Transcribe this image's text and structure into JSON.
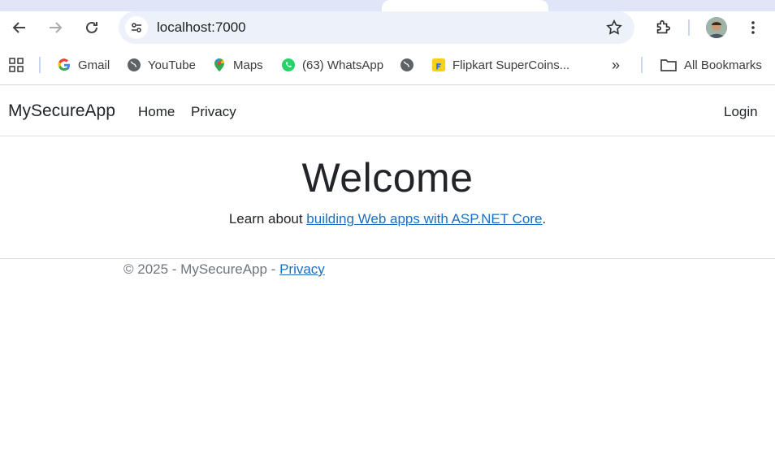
{
  "browser": {
    "url": "localhost:7000",
    "bookmarks": [
      {
        "label": "Gmail",
        "icon": "google-g-icon"
      },
      {
        "label": "YouTube",
        "icon": "globe-icon"
      },
      {
        "label": "Maps",
        "icon": "maps-pin-icon"
      },
      {
        "label": "(63) WhatsApp",
        "icon": "whatsapp-icon"
      },
      {
        "label": "",
        "icon": "globe-icon"
      },
      {
        "label": "Flipkart SuperCoins...",
        "icon": "flipkart-icon"
      }
    ],
    "overflow_label": "»",
    "all_bookmarks_label": "All Bookmarks"
  },
  "navbar": {
    "brand": "MySecureApp",
    "links": [
      "Home",
      "Privacy"
    ],
    "login": "Login"
  },
  "main": {
    "heading": "Welcome",
    "learn_prefix": "Learn about ",
    "learn_link": "building Web apps with ASP.NET Core",
    "learn_suffix": "."
  },
  "footer": {
    "text": "© 2025 - MySecureApp - ",
    "link": "Privacy"
  }
}
